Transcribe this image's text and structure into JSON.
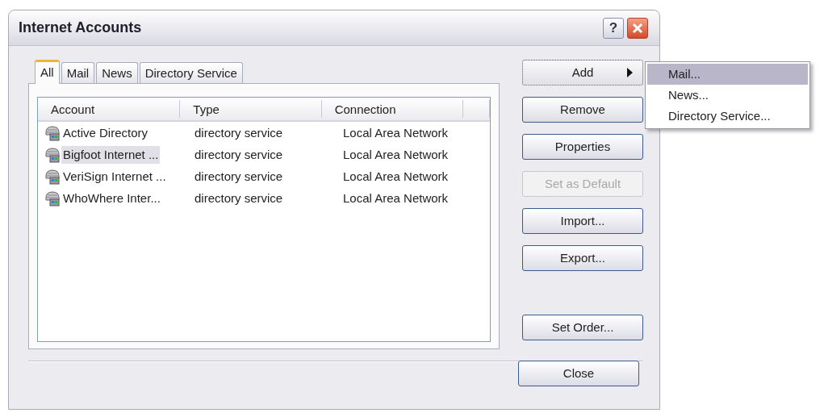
{
  "window": {
    "title": "Internet Accounts",
    "help_button": "?"
  },
  "tabs": [
    {
      "label": "All",
      "selected": true
    },
    {
      "label": "Mail",
      "selected": false
    },
    {
      "label": "News",
      "selected": false
    },
    {
      "label": "Directory Service",
      "selected": false
    }
  ],
  "table": {
    "columns": [
      "Account",
      "Type",
      "Connection"
    ],
    "rows": [
      {
        "account": "Active Directory",
        "type": "directory service",
        "connection": "Local Area Network",
        "selected": false
      },
      {
        "account": "Bigfoot Internet ...",
        "type": "directory service",
        "connection": "Local Area Network",
        "selected": true
      },
      {
        "account": "VeriSign Internet ...",
        "type": "directory service",
        "connection": "Local Area Network",
        "selected": false
      },
      {
        "account": "WhoWhere Inter...",
        "type": "directory service",
        "connection": "Local Area Network",
        "selected": false
      }
    ]
  },
  "buttons": [
    {
      "label": "Add",
      "kind": "submenu",
      "disabled": false,
      "focused": true
    },
    {
      "label": "Remove",
      "kind": "plain",
      "disabled": false,
      "focused": false
    },
    {
      "label": "Properties",
      "kind": "plain",
      "disabled": false,
      "focused": false
    },
    {
      "label": "Set as Default",
      "kind": "plain",
      "disabled": true,
      "focused": false
    },
    {
      "label": "Import...",
      "kind": "plain",
      "disabled": false,
      "focused": false
    },
    {
      "label": "Export...",
      "kind": "plain",
      "disabled": false,
      "focused": false
    },
    {
      "label": "Set Order...",
      "kind": "spaced",
      "disabled": false,
      "focused": false
    }
  ],
  "close_button": "Close",
  "add_menu": [
    {
      "label": "Mail...",
      "selected": true
    },
    {
      "label": "News...",
      "selected": false
    },
    {
      "label": "Directory Service...",
      "selected": false
    }
  ]
}
